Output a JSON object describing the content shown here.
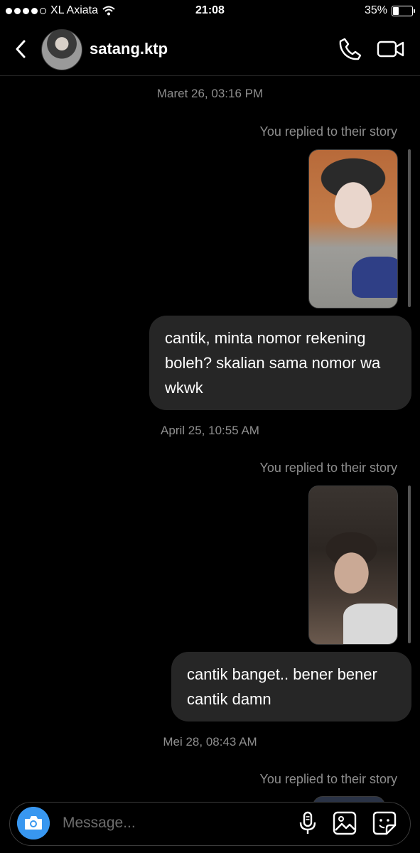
{
  "status_bar": {
    "carrier": "XL Axiata",
    "time": "21:08",
    "battery": "35%",
    "battery_level": 0.35,
    "signal_bars": 4
  },
  "header": {
    "username": "satang.ktp",
    "icons": [
      "back-chevron-icon",
      "phone-icon",
      "video-camera-icon"
    ]
  },
  "thread": [
    {
      "type": "timestamp",
      "text": "Maret 26, 03:16 PM"
    },
    {
      "type": "replied_label",
      "text": "You replied to their story"
    },
    {
      "type": "story_thumbnail"
    },
    {
      "type": "message",
      "text": "cantik, minta nomor rekening boleh? skalian sama nomor wa wkwk"
    },
    {
      "type": "timestamp",
      "text": "April 25, 10:55 AM"
    },
    {
      "type": "replied_label",
      "text": "You replied to their story"
    },
    {
      "type": "story_thumbnail"
    },
    {
      "type": "message",
      "text": "cantik banget.. bener bener cantik damn"
    },
    {
      "type": "timestamp",
      "text": "Mei 28, 08:43 AM"
    },
    {
      "type": "replied_label",
      "text": "You replied to their story"
    }
  ],
  "composer": {
    "placeholder": "Message...",
    "icons": [
      "camera-icon",
      "microphone-icon",
      "gallery-icon",
      "sticker-icon"
    ]
  },
  "colors": {
    "background": "#000000",
    "bubble": "#262626",
    "secondary_text": "#8e8e8e",
    "camera_button": "#3897f0"
  }
}
